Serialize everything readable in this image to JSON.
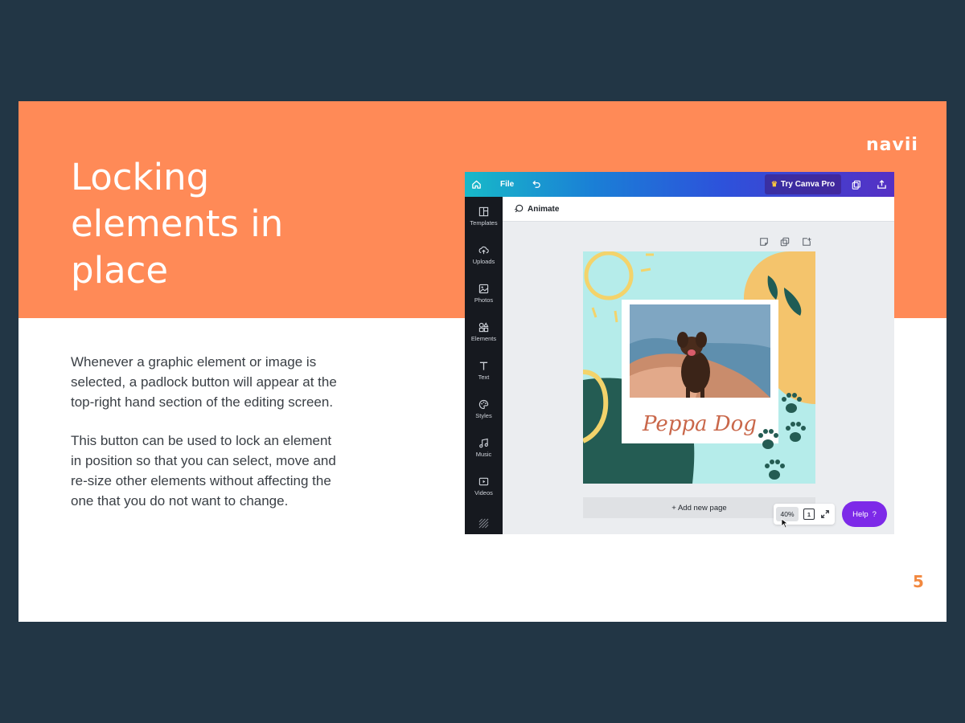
{
  "slide": {
    "brand": "navii",
    "title_lines": [
      "Locking",
      "elements in",
      "place"
    ],
    "paragraphs": [
      "Whenever a graphic element or image is selected, a padlock button will appear at the top-right hand section of the editing screen.",
      "This button can be used to lock an element in position so that you can select, move and re-size other elements without affecting the one that you do not want to change."
    ],
    "page_number": "5",
    "colors": {
      "band": "#ff8a57",
      "background": "#223645",
      "page_number": "#f2883f"
    }
  },
  "editor": {
    "topbar": {
      "home_icon": "home-icon",
      "file_label": "File",
      "undo_icon": "undo-icon",
      "try_pro_label": "Try Canva Pro",
      "crown_icon": "crown-icon",
      "copy_icon": "copy-icon",
      "share_icon": "share-icon"
    },
    "sidebar": [
      {
        "label": "Templates",
        "icon": "templates-icon"
      },
      {
        "label": "Uploads",
        "icon": "uploads-icon"
      },
      {
        "label": "Photos",
        "icon": "photos-icon"
      },
      {
        "label": "Elements",
        "icon": "elements-icon"
      },
      {
        "label": "Text",
        "icon": "text-icon"
      },
      {
        "label": "Styles",
        "icon": "styles-icon"
      },
      {
        "label": "Music",
        "icon": "music-icon"
      },
      {
        "label": "Videos",
        "icon": "videos-icon"
      },
      {
        "label": "",
        "icon": "pattern-icon"
      }
    ],
    "animate_label": "Animate",
    "page_tool_icons": [
      "note-icon",
      "duplicate-icon",
      "add-page-icon"
    ],
    "design": {
      "caption": "Peppa Dog"
    },
    "add_page_label": "+ Add new page",
    "zoom_level": "40%",
    "page_count": "1",
    "help_label": "Help",
    "help_mark": "?"
  }
}
